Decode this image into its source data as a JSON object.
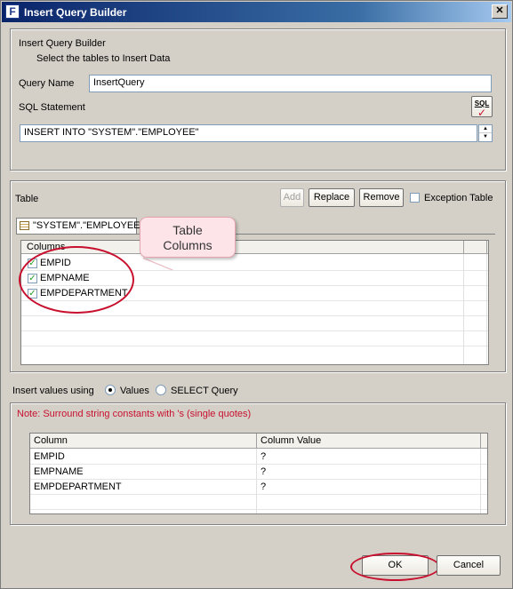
{
  "window": {
    "title": "Insert Query Builder",
    "close_glyph": "✕",
    "app_icon_glyph": "F"
  },
  "header": {
    "title": "Insert Query Builder",
    "subtitle": "Select the tables to Insert Data"
  },
  "query": {
    "name_label": "Query Name",
    "name_value": "InsertQuery",
    "sql_label": "SQL Statement",
    "sql_value": "INSERT INTO \"SYSTEM\".\"EMPLOYEE\"",
    "sql_button": "SQL"
  },
  "table": {
    "label": "Table",
    "buttons": {
      "add": "Add",
      "replace": "Replace",
      "remove": "Remove"
    },
    "exception_label": "Exception Table",
    "tab_label": "\"SYSTEM\".\"EMPLOYEE\"",
    "columns_header": "Columns",
    "columns": [
      "EMPID",
      "EMPNAME",
      "EMPDEPARTMENT"
    ]
  },
  "callout": {
    "line1": "Table",
    "line2": "Columns"
  },
  "insert": {
    "label": "Insert values using",
    "option_values": "Values",
    "option_select": "SELECT Query",
    "note": "Note: Surround string constants with 's (single quotes)",
    "header_column": "Column",
    "header_value": "Column Value",
    "rows": [
      {
        "column": "EMPID",
        "value": "?"
      },
      {
        "column": "EMPNAME",
        "value": "?"
      },
      {
        "column": "EMPDEPARTMENT",
        "value": "?"
      }
    ]
  },
  "footer": {
    "ok": "OK",
    "cancel": "Cancel"
  },
  "colors": {
    "note_red": "#c8102e",
    "highlight_red": "#c8102e",
    "callout_fill": "#fde4e8"
  }
}
